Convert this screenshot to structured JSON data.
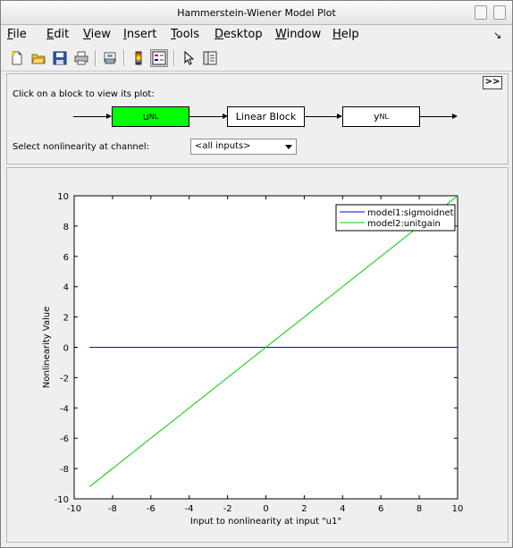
{
  "window": {
    "title": "Hammerstein-Wiener Model Plot"
  },
  "menu": [
    {
      "first": "F",
      "rest": "ile"
    },
    {
      "first": "E",
      "rest": "dit"
    },
    {
      "first": "V",
      "rest": "iew"
    },
    {
      "first": "I",
      "rest": "nsert"
    },
    {
      "first": "T",
      "rest": "ools"
    },
    {
      "first": "D",
      "rest": "esktop"
    },
    {
      "first": "W",
      "rest": "indow"
    },
    {
      "first": "H",
      "rest": "elp"
    }
  ],
  "toolbar_icons": [
    "new-file-icon",
    "open-folder-icon",
    "save-icon",
    "print-icon",
    "print-preview-icon",
    "colorbar-icon",
    "legend-icon",
    "pointer-icon",
    "property-editor-icon"
  ],
  "panel": {
    "instruction": "Click on a block to view its plot:",
    "expand_label": ">>",
    "blocks": {
      "input": {
        "main": "u",
        "sub": "NL"
      },
      "linear": "Linear Block",
      "output": {
        "main": "y",
        "sub": "NL"
      }
    },
    "selected_color": "#00ff00",
    "select_label": "Select nonlinearity at channel:",
    "select_value": "<all inputs>"
  },
  "chart_data": {
    "type": "line",
    "xlabel": "Input to nonlinearity at input \"u1\"",
    "ylabel": "Nonlinearity Value",
    "xlim": [
      -10,
      10
    ],
    "ylim": [
      -10,
      10
    ],
    "xticks": [
      -10,
      -8,
      -6,
      -4,
      -2,
      0,
      2,
      4,
      6,
      8,
      10
    ],
    "yticks": [
      -10,
      -8,
      -6,
      -4,
      -2,
      0,
      2,
      4,
      6,
      8,
      10
    ],
    "legend_position": "top-right",
    "series": [
      {
        "name": "model1:sigmoidnet",
        "color": "#0000ff",
        "x": [
          -9.2,
          10
        ],
        "y": [
          0,
          0
        ]
      },
      {
        "name": "model2:unitgain",
        "color": "#00cc00",
        "x": [
          -9.2,
          10
        ],
        "y": [
          -9.2,
          10
        ]
      }
    ]
  }
}
